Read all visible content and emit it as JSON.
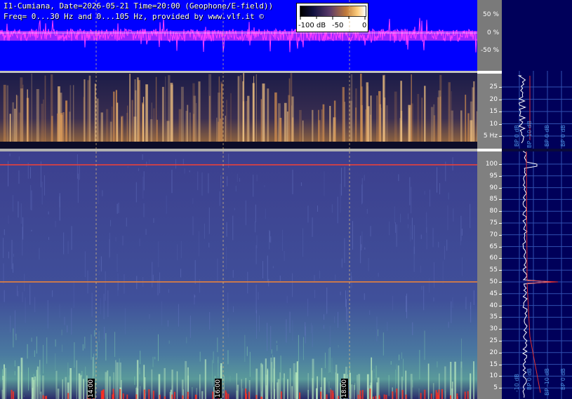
{
  "header": {
    "line1": "I1-Cumiana, Date=2026-05-21 Time=20:00 (Geophone/E-field))",
    "line2": "Freq= 0...30 Hz and 0...105 Hz, provided by www.vlf.it ©"
  },
  "colorbar": {
    "labels": [
      "-100 dB",
      "-50",
      "0"
    ]
  },
  "waveform": {
    "pct_ticks": [
      "50 %",
      "0 %",
      "-50 %"
    ]
  },
  "lf_spectrogram": {
    "ticks": [
      "25",
      "20",
      "15",
      "10",
      "5 Hz"
    ]
  },
  "main_spectrogram": {
    "ticks": [
      "100",
      "95",
      "90",
      "85",
      "80",
      "75",
      "70",
      "65",
      "60",
      "55",
      "50",
      "45",
      "40",
      "35",
      "30",
      "25",
      "20",
      "15",
      "10",
      "5"
    ]
  },
  "time_markers": [
    "14:00",
    "16:00",
    "18:00"
  ],
  "right_panel": {
    "top_labels": [
      "BP 0 dB",
      "BP -10 dB",
      "BP 0 dB",
      "BP 0 dB"
    ],
    "bottom_labels": [
      "-10 dB",
      "BP 0 dB",
      "BP -10 dB",
      "BP 0 dB"
    ]
  }
}
